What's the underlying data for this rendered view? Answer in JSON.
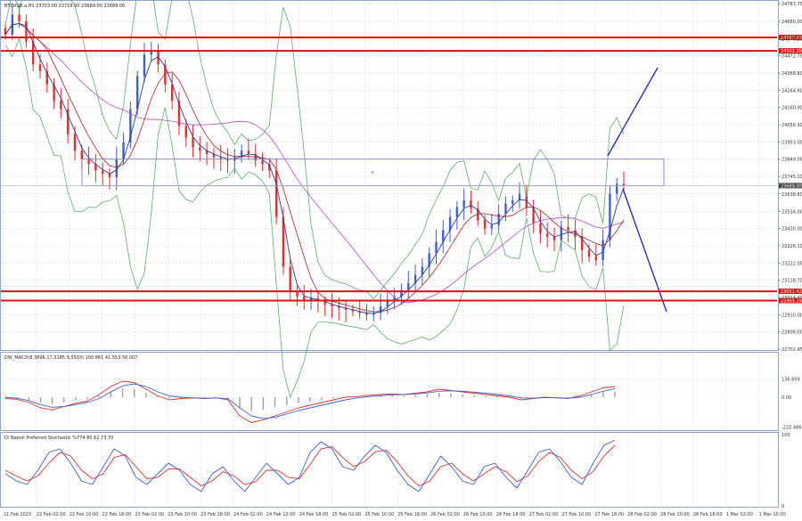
{
  "header": {
    "symbol_info": "BTCUSD.a,H1  23703.00  23719.00  23669.00  23689.00"
  },
  "indicators": {
    "macd_title": "DW_MACD(8,3896.17,3185.9,5503) 100.861 41.553 56.007",
    "stoch_title": "Di Napoli Preferred Stochastic %774 80.62 73.70"
  },
  "price_axis": {
    "labels": [
      "24787.75",
      "24680.00",
      "24576.50",
      "24472.70",
      "24368.80",
      "24264.60",
      "24160.90",
      "24056.90",
      "23953.00",
      "23849.00",
      "23745.10",
      "23638.80",
      "23534.00",
      "23430.00",
      "23326.10",
      "23222.00",
      "23118.70",
      "23014.40",
      "22910.00",
      "22806.00",
      "22702.45"
    ],
    "current_price": "23689.00",
    "level_tags": [
      "24583.43",
      "24502.39",
      "23051.42",
      "22995.29"
    ]
  },
  "macd_axis": {
    "labels": [
      "136.809",
      "0.00",
      "-222.486"
    ]
  },
  "stoch_axis": {
    "labels": [
      "100",
      "0"
    ]
  },
  "time_axis": {
    "labels": [
      "21 Feb 2023",
      "22 Feb 02:00",
      "22 Feb 10:00",
      "22 Feb 18:00",
      "23 Feb 02:00",
      "23 Feb 10:00",
      "23 Feb 18:00",
      "24 Feb 02:00",
      "24 Feb 10:00",
      "24 Feb 18:00",
      "25 Feb 02:00",
      "25 Feb 10:00",
      "25 Feb 18:00",
      "26 Feb 02:00",
      "26 Feb 10:00",
      "26 Feb 18:00",
      "27 Feb 02:00",
      "27 Feb 10:00",
      "27 Feb 18:00",
      "28 Feb 02:00",
      "28 Feb 10:00",
      "28 Feb 18:00",
      "1 Mar 02:00",
      "1 Mar 10:00"
    ]
  },
  "colors": {
    "bull": "#3f5fd6",
    "bear": "#e03030",
    "level": "#e01010",
    "ma_fast": "#2a3ea0",
    "ma_slow": "#b02020",
    "envelope": "#5aae6e",
    "ma_long": "#b84ad0",
    "projection": "#2020c0",
    "box": "#7f7fd4"
  },
  "chart_data": {
    "type": "candlestick",
    "symbol": "BTCUSD.a",
    "timeframe": "H1",
    "ohlc_last": {
      "open": 23703.0,
      "high": 23719.0,
      "low": 23669.0,
      "close": 23689.0
    },
    "ylim": [
      22702.45,
      24787.75
    ],
    "horizontal_levels": [
      24583.43,
      24502.39,
      23051.42,
      22995.29
    ],
    "grid": true,
    "close_series": [
      24600,
      24720,
      24680,
      24560,
      24420,
      24380,
      24300,
      24200,
      24150,
      24000,
      23900,
      23850,
      23820,
      23780,
      23760,
      23740,
      23850,
      23950,
      24150,
      24350,
      24480,
      24500,
      24420,
      24300,
      24200,
      24050,
      23980,
      23920,
      23900,
      23880,
      23860,
      23850,
      23840,
      23860,
      23900,
      23880,
      23840,
      23820,
      23780,
      23500,
      23200,
      23050,
      23020,
      23000,
      23010,
      22990,
      22970,
      22960,
      22950,
      22940,
      22930,
      22920,
      22910,
      22920,
      22960,
      22990,
      23020,
      23060,
      23100,
      23150,
      23200,
      23280,
      23350,
      23420,
      23500,
      23560,
      23600,
      23550,
      23480,
      23430,
      23450,
      23520,
      23580,
      23600,
      23640,
      23560,
      23460,
      23400,
      23380,
      23360,
      23440,
      23420,
      23380,
      23300,
      23260,
      23240,
      23360,
      23640,
      23700,
      23689
    ],
    "macd": {
      "main": [
        -10,
        -15,
        -40,
        -80,
        -95,
        -70,
        -45,
        -30,
        20,
        80,
        120,
        110,
        60,
        10,
        -20,
        -10,
        -5,
        -10,
        -5,
        -20,
        -140,
        -190,
        -170,
        -140,
        -110,
        -80,
        -60,
        -40,
        -20,
        0,
        5,
        15,
        20,
        25,
        20,
        30,
        40,
        60,
        50,
        40,
        30,
        20,
        10,
        0,
        -20,
        -10,
        0,
        -5,
        -10,
        10,
        40,
        70,
        80
      ],
      "signal": [
        0,
        -8,
        -25,
        -55,
        -75,
        -70,
        -55,
        -40,
        -10,
        40,
        85,
        100,
        80,
        40,
        10,
        0,
        -5,
        -8,
        -5,
        -12,
        -80,
        -140,
        -160,
        -150,
        -125,
        -100,
        -80,
        -60,
        -40,
        -20,
        -5,
        5,
        12,
        18,
        20,
        25,
        32,
        45,
        48,
        45,
        38,
        30,
        20,
        10,
        -5,
        -8,
        -3,
        -4,
        -8,
        0,
        20,
        45,
        65
      ],
      "histogram": [
        -10,
        -15,
        -40,
        -80,
        -95,
        -70,
        -45,
        -30,
        20,
        80,
        120,
        110,
        60,
        10,
        -20,
        -10,
        -5,
        -10,
        -5,
        -20,
        -140,
        -190,
        -170,
        -140,
        -110,
        -80,
        -60,
        -40,
        -20,
        0,
        5,
        15,
        20,
        25,
        20,
        30,
        40,
        60,
        50,
        40,
        30,
        20,
        10,
        0,
        -20,
        -10,
        0,
        -5,
        -10,
        10,
        40,
        70,
        80
      ]
    },
    "stochastic": {
      "k": [
        45,
        35,
        30,
        50,
        75,
        80,
        60,
        35,
        30,
        55,
        80,
        70,
        40,
        30,
        45,
        60,
        50,
        30,
        20,
        45,
        55,
        35,
        20,
        40,
        60,
        45,
        30,
        40,
        75,
        90,
        80,
        55,
        50,
        70,
        85,
        75,
        50,
        30,
        20,
        45,
        70,
        55,
        35,
        30,
        55,
        60,
        40,
        25,
        50,
        75,
        80,
        62,
        40,
        30,
        60,
        85,
        92
      ],
      "d": [
        50,
        42,
        35,
        42,
        60,
        75,
        70,
        50,
        38,
        45,
        68,
        72,
        55,
        38,
        40,
        52,
        52,
        40,
        28,
        35,
        48,
        42,
        30,
        34,
        50,
        50,
        40,
        38,
        58,
        80,
        83,
        68,
        55,
        62,
        76,
        78,
        62,
        42,
        28,
        35,
        55,
        60,
        45,
        35,
        45,
        55,
        48,
        34,
        42,
        62,
        75,
        68,
        50,
        38,
        48,
        70,
        85
      ]
    }
  }
}
